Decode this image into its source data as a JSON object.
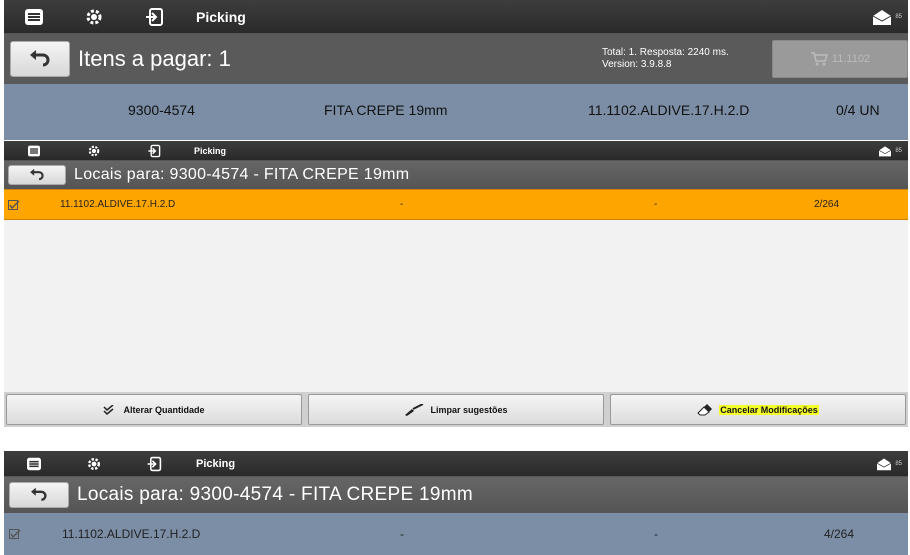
{
  "screen1": {
    "topbar": {
      "title": "Picking",
      "mail_badge": "85"
    },
    "items_label": "Itens a pagar: 1",
    "info_total": "Total: 1. Resposta: 2240 ms.",
    "info_version": "Version: 3.9.8.8",
    "cart_button": "11.1102",
    "row": {
      "code": "9300-4574",
      "description": "FITA CREPE 19mm",
      "location": "11.1102.ALDIVE.17.H.2.D",
      "qty": "0/4 UN"
    }
  },
  "screen2": {
    "topbar": {
      "title": "Picking",
      "mail_badge": "85"
    },
    "header": "Locais para: 9300-4574 - FITA CREPE 19mm",
    "row": {
      "location": "11.1102.ALDIVE.17.H.2.D",
      "col2": "-",
      "col3": "-",
      "qty": "2/264"
    },
    "buttons": {
      "alterar": "Alterar Quantidade",
      "limpar": "Limpar sugestões",
      "cancelar": "Cancelar Modificações"
    }
  },
  "screen3": {
    "topbar": {
      "title": "Picking",
      "mail_badge": "85"
    },
    "header": "Locais para: 9300-4574 - FITA CREPE 19mm",
    "row": {
      "location": "11.1102.ALDIVE.17.H.2.D",
      "col2": "-",
      "col3": "-",
      "qty": "4/264"
    }
  },
  "colors": {
    "selected_row": "#ffa500",
    "row_blue": "#7b8ea6",
    "highlight": "#f5ff2a"
  }
}
